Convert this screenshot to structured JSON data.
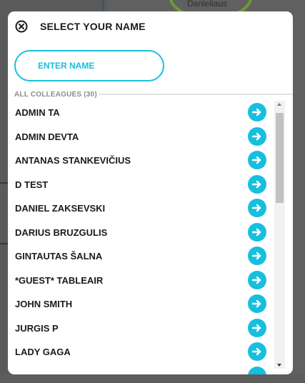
{
  "background": {
    "partial_name": "Danieliaus"
  },
  "modal": {
    "title": "SELECT YOUR NAME",
    "close_icon": "close-circle-icon",
    "name_input": {
      "placeholder": "ENTER NAME",
      "value": ""
    },
    "section_label": "ALL COLLEAGUES (30)",
    "colleagues": [
      "ADMIN TA",
      "ADMIN DEVTA",
      "ANTANAS STANKEVIČIUS",
      "D TEST",
      "DANIEL ZAKSEVSKI",
      "DARIUS BRUZGULIS",
      "GINTAUTAS ŠALNA",
      "*GUEST* TABLEAIR",
      "JOHN SMITH",
      "JURGIS P",
      "LADY GAGA"
    ],
    "arrow_icon": "arrow-right-icon"
  },
  "colors": {
    "accent": "#16bfdd",
    "text": "#1b1b1b",
    "muted": "#8d8d8d",
    "overlay": "#606060",
    "background_ring": "#6e9a34"
  }
}
